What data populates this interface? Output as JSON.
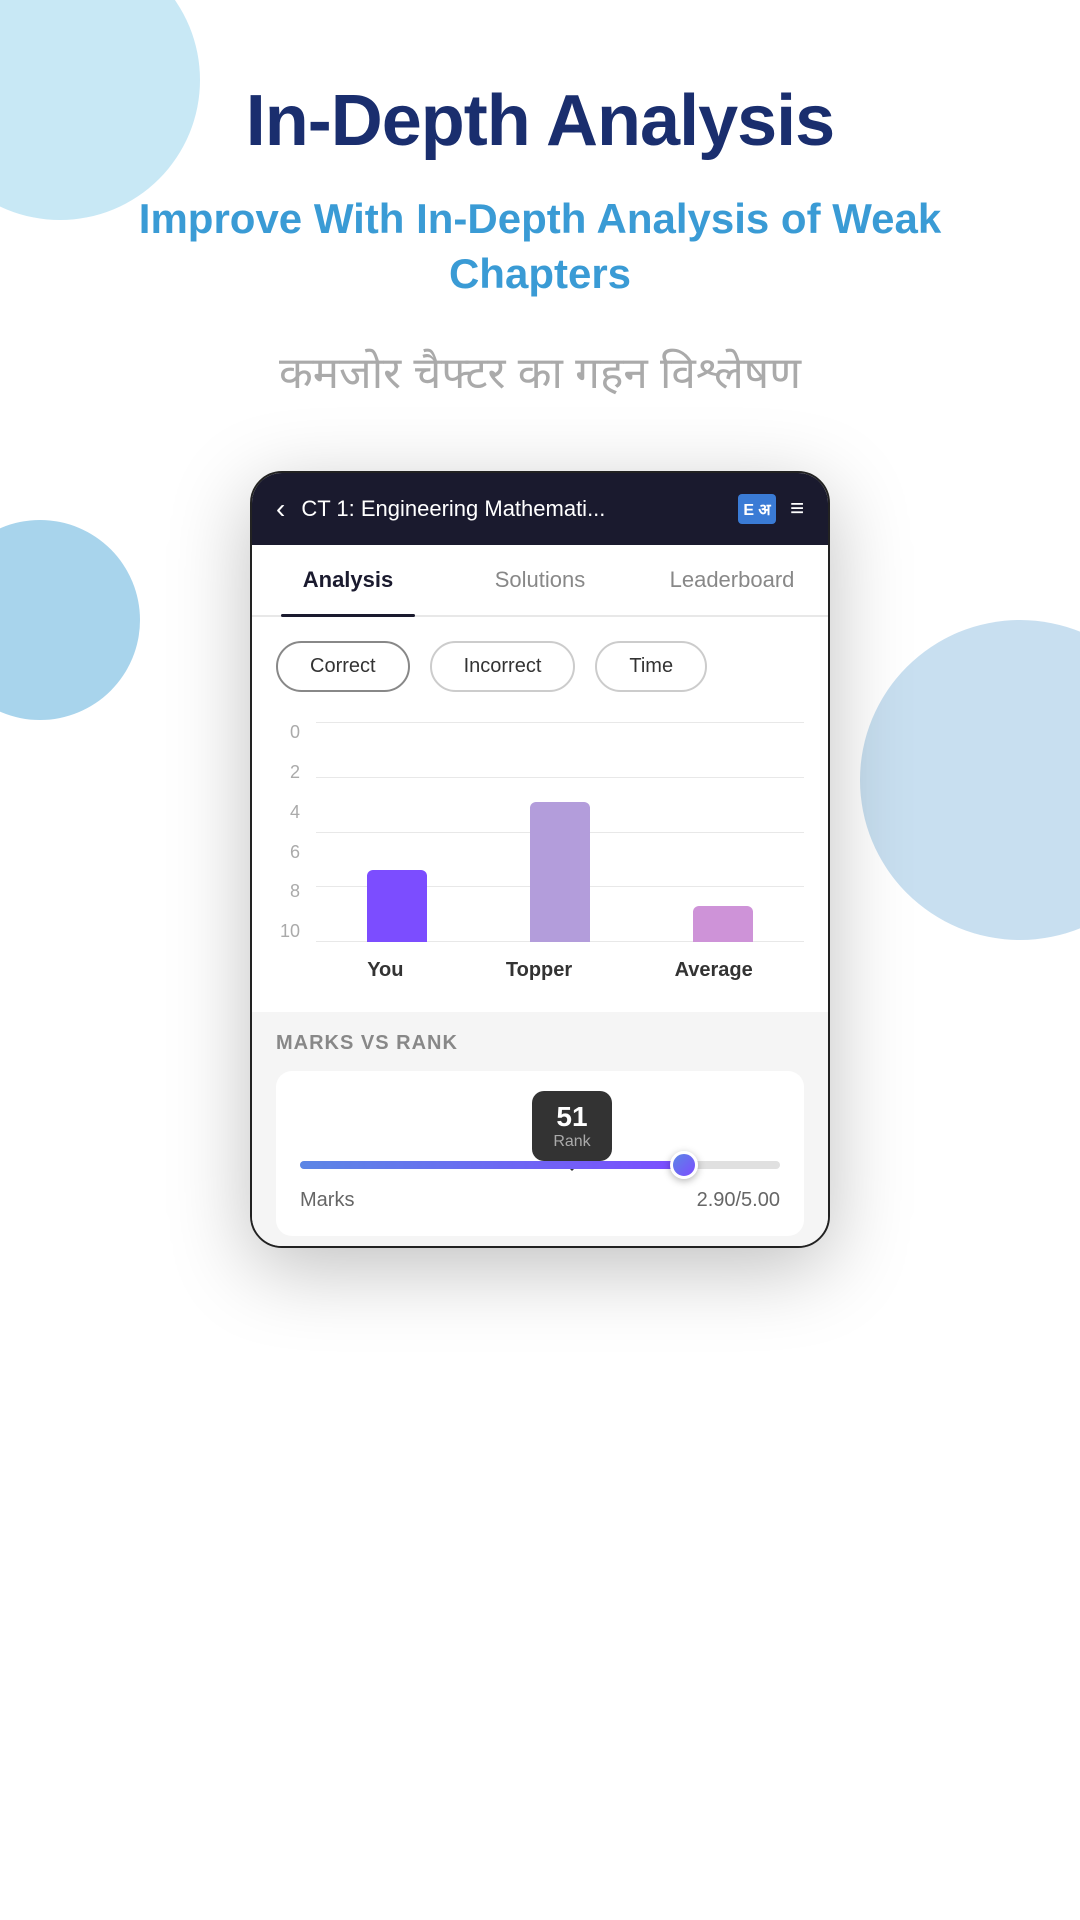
{
  "page": {
    "main_title": "In-Depth Analysis",
    "subtitle": "Improve With In-Depth Analysis of Weak Chapters",
    "hindi_text": "कमजोर चैफ्टर का गहन विश्लेषण"
  },
  "app_header": {
    "title": "CT 1: Engineering Mathemati...",
    "back_icon": "‹",
    "menu_icon": "≡",
    "book_icon_text": "E अ"
  },
  "tabs": [
    {
      "label": "Analysis",
      "active": true
    },
    {
      "label": "Solutions",
      "active": false
    },
    {
      "label": "Leaderboard",
      "active": false
    }
  ],
  "filters": [
    {
      "label": "Correct",
      "active": true
    },
    {
      "label": "Incorrect",
      "active": false
    },
    {
      "label": "Time",
      "active": false
    }
  ],
  "chart": {
    "y_labels": [
      "0",
      "2",
      "4",
      "6",
      "8",
      "10"
    ],
    "bars": [
      {
        "label": "You",
        "height_pct": 40
      },
      {
        "label": "Topper",
        "height_pct": 70
      },
      {
        "label": "Average",
        "height_pct": 18
      }
    ]
  },
  "marks_vs_rank": {
    "heading": "MARKS VS RANK",
    "rank_number": "51",
    "rank_label": "Rank",
    "marks_label": "Marks",
    "marks_value": "2.90/5.00",
    "slider_fill_pct": 80
  }
}
